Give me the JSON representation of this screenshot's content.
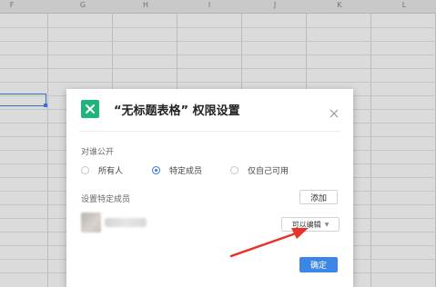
{
  "sheet": {
    "columns": [
      "F",
      "G",
      "H",
      "I",
      "J",
      "K",
      "L"
    ]
  },
  "dialog": {
    "title": "“无标题表格” 权限设置",
    "logo_icon": "spreadsheet-logo-icon",
    "close_icon": "close-icon",
    "visibility_label": "对谁公开",
    "options": [
      {
        "label": "所有人",
        "selected": false
      },
      {
        "label": "特定成员",
        "selected": true
      },
      {
        "label": "仅自己可用",
        "selected": false
      }
    ],
    "members_label": "设置特定成员",
    "add_button": "添加",
    "member_permission": "可以编辑",
    "confirm_button": "确定"
  },
  "colors": {
    "accent": "#3c86e8",
    "logo": "#1fb57a",
    "arrow": "#e8332a"
  }
}
